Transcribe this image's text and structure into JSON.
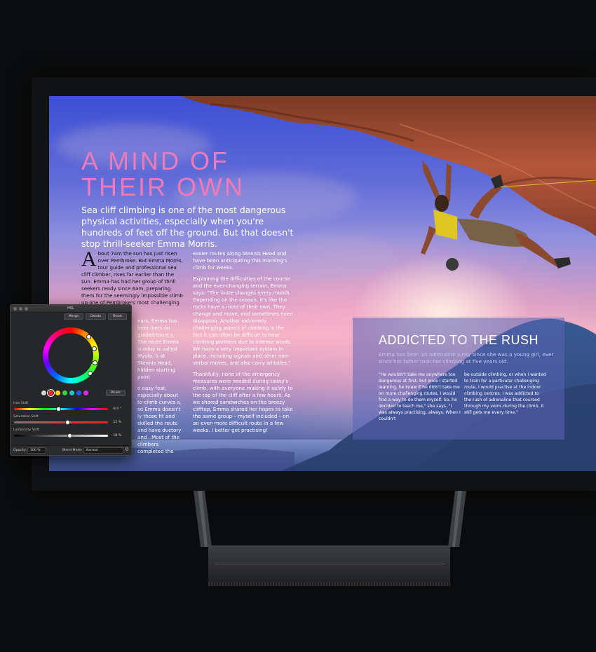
{
  "magazine": {
    "headline_line1": "A MIND OF",
    "headline_line2": "THEIR OWN",
    "lede": "Sea cliff climbing is one of the most dangerous physical activities, especially when you're hundreds of feet off the ground. But that doesn't stop thrill-seeker Emma Morris.",
    "dropcap": "A",
    "col1_p1": "bout 7am the sun has just risen over Pembroke. But Emma Morris, tour guide and professional sea cliff climber, rises far earlier than the sun. Emma has had her group of thrill seekers ready since 6am, preparing them for the seemingly impossible climb up one of Pembroke's most challenging sea cliffs –",
    "col1_p2": "ears, Emma has been bers on guided tours s. The route Emma is oday is called Myola, b at Stennis Head, hidden starting point",
    "col1_p3": "o easy feat, especially about to climb curves s, so Emma doesn't ly those fit and skilled the route and have ductory and . Most of the climbers completed the",
    "col2_p1": "easier routes along Stennis Head and have been anticipating this morning's climb for weeks.",
    "col2_p2": "Explaining the difficulties of the course and the ever-changing terrain, Emma says: \"The route changes every month. Depending on the season, it's like the rocks have a mind of their own. They change and move, and sometimes even disappear. Another extremely challenging aspect of climbing is the fact it can often be difficult to hear climbing partners due to intense winds. We have a very important system in place, including signals and other non-verbal moves, and also carry whistles.\"",
    "col2_p3": "Thankfully, none of the emergency measures were needed during today's climb, with everyone making it safely to the top of the cliff after a few hours. As we shared sandwiches on the breezy clifftop, Emma shared her hopes to take the same group – myself included – on an even more difficult route in a few weeks. I better get practising!",
    "side_title": "ADDICTED TO THE RUSH",
    "side_intro": "Emma has been an adrenaline junky since she was a young girl, ever since her father took her climbing at five years old.",
    "side_col1": "\"He wouldn't take me anywhere too dangerous at first, but once I started learning, he knew if he didn't take me on more challenging routes, I would find a way to do them myself. So, he decided to teach me,\" she says. \"I was always practising, always. When I couldn't",
    "side_col2": "be outside climbing, or when I wanted to train for a particular challenging route, I would practise at the indoor climbing centres. I was addicted to the rush of adrenaline that coursed through my veins during the climb. It still gets me every time.\""
  },
  "hsl_panel": {
    "title": "HSL",
    "buttons": {
      "merge": "Merge",
      "delete": "Delete",
      "reset": "Reset"
    },
    "picker": "Picker",
    "swatches": [
      "#d6d6d6",
      "#ff2b2b",
      "#ffd11a",
      "#35d63a",
      "#19c7c7",
      "#2a55ff",
      "#e02be0"
    ],
    "hue_label": "Hue Shift",
    "hue_value": "-8.9 °",
    "hue_level": 0.47,
    "sat_label": "Saturation Shift",
    "sat_value": "15 %",
    "sat_level": 0.57,
    "lum_label": "Luminosity Shift",
    "lum_value": "18 %",
    "lum_level": 0.59,
    "opacity_label": "Opacity:",
    "opacity_value": "100 %",
    "blend_label": "Blend Mode:",
    "blend_value": "Normal"
  },
  "colors": {
    "headline": "#f07ab9",
    "panel_bg": "#262728"
  }
}
